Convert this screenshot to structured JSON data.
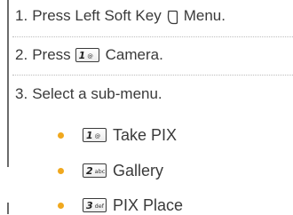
{
  "steps": [
    {
      "number": "1.",
      "text_before": "Press Left Soft Key",
      "icon": "left-soft-key-icon",
      "text_after": "Menu."
    },
    {
      "number": "2.",
      "text_before": "Press",
      "key": {
        "main": "1",
        "sub": "@"
      },
      "text_after": "Camera."
    },
    {
      "number": "3.",
      "text": "Select a sub-menu."
    }
  ],
  "submenu": [
    {
      "key": {
        "main": "1",
        "sub": "@"
      },
      "label": "Take PIX"
    },
    {
      "key": {
        "main": "2",
        "sub": "abc"
      },
      "label": "Gallery"
    },
    {
      "key": {
        "main": "3",
        "sub": "def"
      },
      "label": "PIX Place"
    }
  ],
  "colors": {
    "bullet": "#f0a81e",
    "text": "#3a3a3a",
    "divider": "#bdbdbd"
  }
}
